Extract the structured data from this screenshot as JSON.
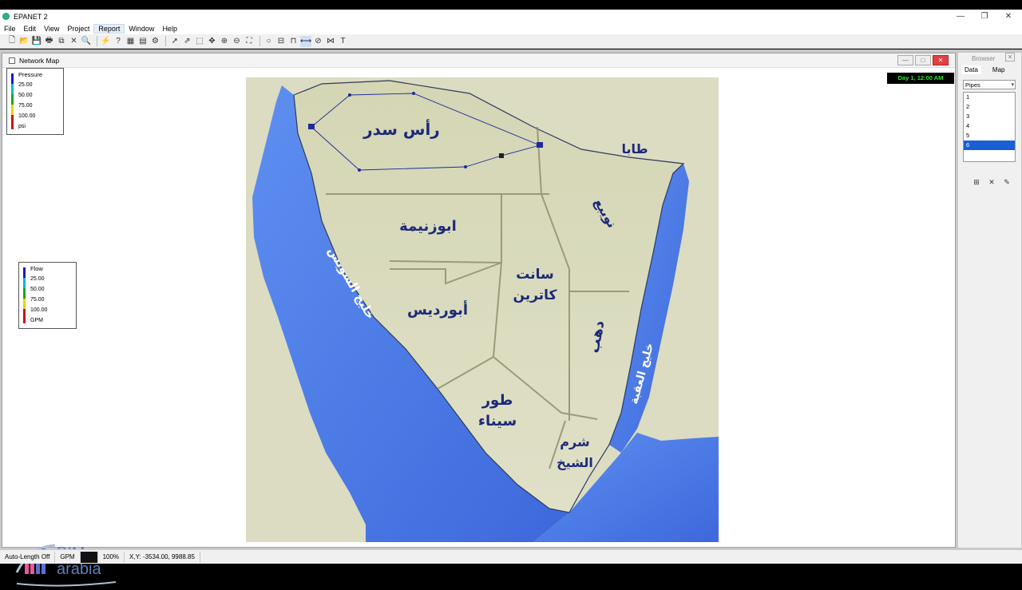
{
  "window": {
    "title": "EPANET 2"
  },
  "menu": [
    "File",
    "Edit",
    "View",
    "Project",
    "Report",
    "Window",
    "Help"
  ],
  "map_window": {
    "title": "Network Map",
    "clock": "Day 1, 12:00 AM"
  },
  "pressure_legend": {
    "title": "Pressure",
    "values": [
      "25.00",
      "50.00",
      "75.00",
      "100.00"
    ],
    "unit": "psi"
  },
  "flow_legend": {
    "title": "Flow",
    "values": [
      "25.00",
      "50.00",
      "75.00",
      "100.00"
    ],
    "unit": "GPM"
  },
  "map_labels": {
    "ras_sedr": "رأس سدر",
    "taba": "طابا",
    "nuweiba": "نويبع",
    "abu_zenima": "ابوزنيمة",
    "st_catherine_1": "سانت",
    "st_catherine_2": "كاترين",
    "abu_redis": "أبورديس",
    "dahab": "دهب",
    "tur_1": "طور",
    "tur_2": "سيناء",
    "sharm_1": "شرم",
    "sharm_2": "الشيخ",
    "gulf_suez": "خليج السويس",
    "gulf_aqaba": "خليج العقبة"
  },
  "browser": {
    "title": "Browser",
    "tabs": [
      "Data",
      "Map"
    ],
    "category": "Pipes",
    "items": [
      "1",
      "2",
      "3",
      "4",
      "5",
      "6"
    ],
    "selected": "6"
  },
  "status": {
    "auto_length": "Auto-Length Off",
    "flow_units": "GPM",
    "zoom": "100%",
    "coords": "X,Y: -3534.00, 9988.85"
  },
  "watermark": {
    "line1": "BIM",
    "line2": "arabia"
  },
  "colors": {
    "legend_blue": "#1a1ab8",
    "legend_cyan": "#00b7d8",
    "legend_green": "#1aa51a",
    "legend_yellow": "#e5d10a",
    "legend_red": "#c81414",
    "sea": "#4a78e8",
    "land": "#d8dcbd"
  }
}
